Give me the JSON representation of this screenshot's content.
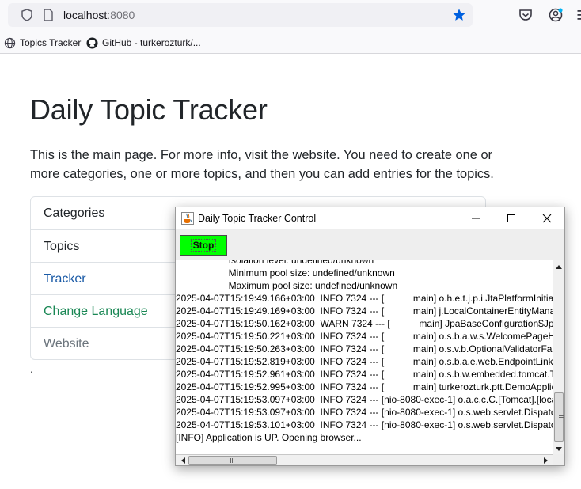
{
  "browser": {
    "url_host": "localhost",
    "url_port": ":8080",
    "bookmarks": [
      {
        "label": "Topics Tracker"
      },
      {
        "label": "GitHub - turkerozturk/..."
      }
    ]
  },
  "page": {
    "title": "Daily Topic Tracker",
    "lead": "This is the main page. For more info, visit the website. You need to create one or more categories, one or more topics, and then you can add entries for the topics.",
    "menu": [
      {
        "label": "Categories"
      },
      {
        "label": "Topics"
      },
      {
        "label": "Tracker"
      },
      {
        "label": "Change Language"
      },
      {
        "label": "Website"
      }
    ],
    "trailing_dot": "."
  },
  "control_window": {
    "title": "Daily Topic Tracker Control",
    "stop_label": "Stop",
    "log_lines": [
      "                    Isolation level: undefined/unknown",
      "                    Minimum pool size: undefined/unknown",
      "                    Maximum pool size: undefined/unknown",
      "2025-04-07T15:19:49.166+03:00  INFO 7324 --- [           main] o.h.e.t.j.p.i.JtaPlatformInitiator",
      "2025-04-07T15:19:49.169+03:00  INFO 7324 --- [           main] j.LocalContainerEntityManagerFactoryBean",
      "2025-04-07T15:19:50.162+03:00  WARN 7324 --- [           main] JpaBaseConfiguration$JpaWebConfiguration",
      "2025-04-07T15:19:50.221+03:00  INFO 7324 --- [           main] o.s.b.a.w.s.WelcomePageHandlerMapping",
      "2025-04-07T15:19:50.263+03:00  INFO 7324 --- [           main] o.s.v.b.OptionalValidatorFactoryBean",
      "2025-04-07T15:19:52.819+03:00  INFO 7324 --- [           main] o.s.b.a.e.web.EndpointLinksResolver",
      "2025-04-07T15:19:52.961+03:00  INFO 7324 --- [           main] o.s.b.w.embedded.tomcat.TomcatWebServer",
      "2025-04-07T15:19:52.995+03:00  INFO 7324 --- [           main] turkerozturk.ptt.DemoApplication",
      "2025-04-07T15:19:53.097+03:00  INFO 7324 --- [nio-8080-exec-1] o.a.c.c.C.[Tomcat].[localhost].[/]",
      "2025-04-07T15:19:53.097+03:00  INFO 7324 --- [nio-8080-exec-1] o.s.web.servlet.DispatcherServlet",
      "2025-04-07T15:19:53.101+03:00  INFO 7324 --- [nio-8080-exec-1] o.s.web.servlet.DispatcherServlet",
      "[INFO] Application is UP. Opening browser..."
    ]
  },
  "colors": {
    "accent_blue": "#0060df",
    "stop_green": "#00ff00",
    "link_green": "#198754"
  },
  "icons": {
    "shield": "shield-icon",
    "page": "page-icon",
    "star": "star-icon",
    "pocket": "pocket-icon",
    "account": "account-icon",
    "menu": "hamburger-menu-icon",
    "globe": "globe-icon",
    "github": "github-icon",
    "java": "java-cup-icon"
  }
}
